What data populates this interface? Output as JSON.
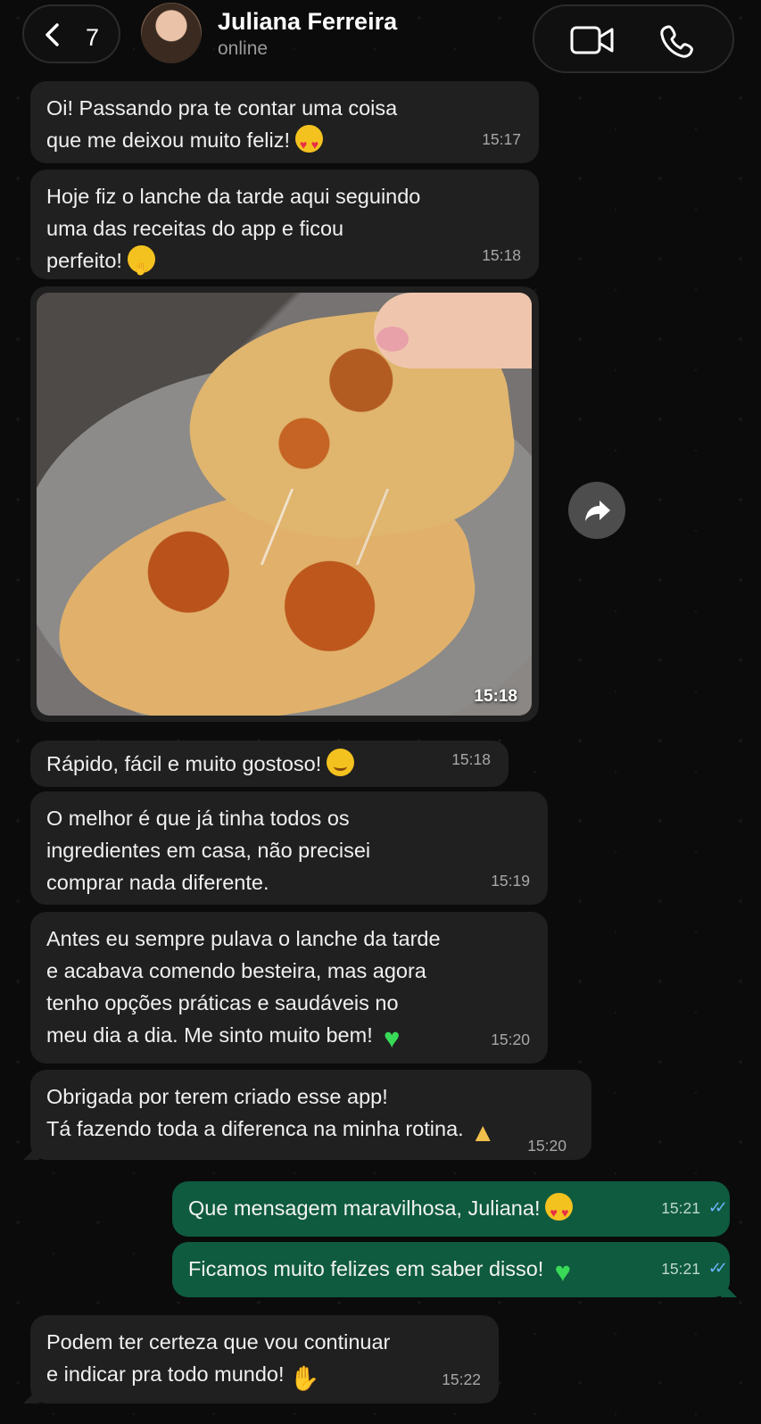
{
  "header": {
    "unread_count": "7",
    "contact_name": "Juliana Ferreira",
    "contact_status": "online",
    "icons": [
      "chevron-left-icon",
      "video-call-icon",
      "phone-call-icon"
    ]
  },
  "messages": [
    {
      "text": "Oi! Passando pra te contar uma coisa\nque me deixou muito feliz!",
      "emoji": "smiling-face-with-heart-eyes",
      "time": "15:17"
    },
    {
      "text": "Hoje fiz o lanche da tarde aqui seguindo\numa das receitas do app e ficou\nperfeito!",
      "emoji": "face-with-hand-over-mouth",
      "time": "15:18"
    },
    {
      "image": "photo-of-golden-stuffed-crepioca-with-melted-cheese",
      "time": "15:18"
    },
    {
      "text": "Rápido, fácil e muito gostoso!",
      "emoji": "smiling-face",
      "time": "15:18"
    },
    {
      "text": "O melhor é que já tinha todos os\ningredientes em casa, não precisei\ncomprar nada diferente.",
      "time": "15:19"
    },
    {
      "text": "Antes eu sempre pulava o lanche da tarde\ne acabava comendo besteira, mas agora\ntenho opções práticas e saudáveis no\nmeu dia a dia. Me sinto muito bem!",
      "emoji": "green-heart",
      "time": "15:20"
    },
    {
      "text": "Obrigada por terem criado esse app!\nTá fazendo toda a diferenca na minha rotina.",
      "emoji": "folded-hands",
      "time": "15:20"
    },
    {
      "text": "Que mensagem maravilhosa, Juliana!",
      "emoji": "smiling-face-with-heart-eyes",
      "time": "15:21",
      "read": true
    },
    {
      "text": "Ficamos muito felizes em saber disso!",
      "emoji": "green-heart",
      "time": "15:21",
      "read": true
    },
    {
      "text": "Podem ter certeza que vou continuar\ne indicar pra todo mundo!",
      "emoji": "clapping-hands",
      "time": "15:22"
    }
  ],
  "colors": {
    "background": "#0b0b0b",
    "incoming_bubble": "#202020",
    "outgoing_bubble": "#0f5b3f",
    "read_ticks": "#6db6ff"
  }
}
